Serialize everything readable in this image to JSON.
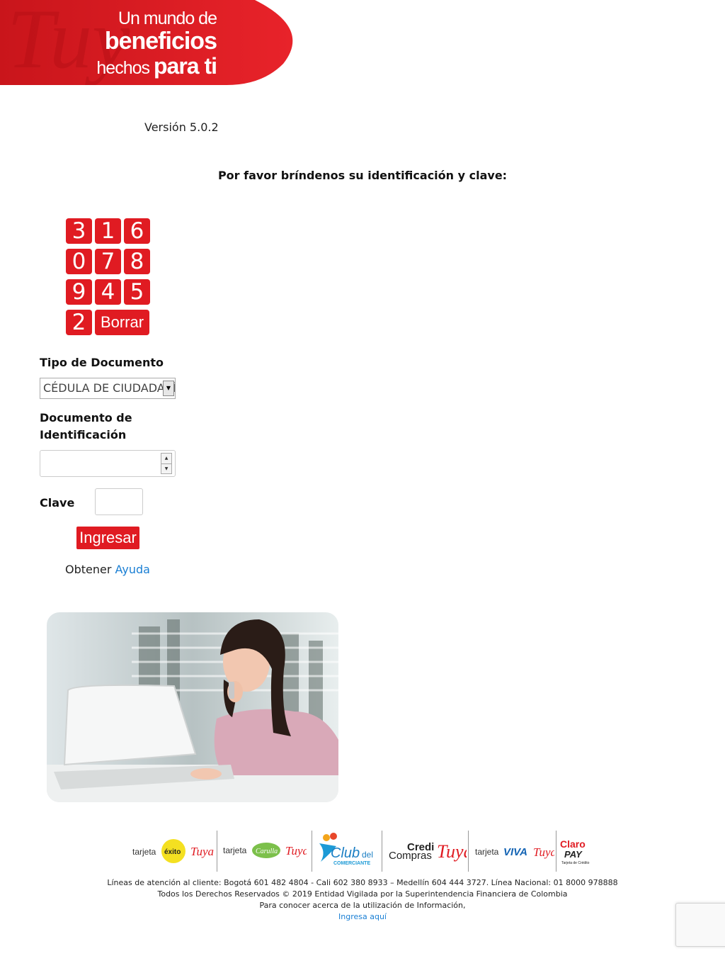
{
  "banner": {
    "line1": "Un mundo de",
    "line2": "beneficios",
    "line3a": "hechos",
    "line3b": "para ti",
    "brand_color": "#e01b22"
  },
  "version": "Versión 5.0.2",
  "prompt": "Por favor bríndenos su identificación y clave:",
  "keypad": {
    "keys": [
      "3",
      "1",
      "6",
      "0",
      "7",
      "8",
      "9",
      "4",
      "5",
      "2"
    ],
    "delete_label": "Borrar"
  },
  "form": {
    "doc_type_label": "Tipo de Documento",
    "doc_type_value": "CÉDULA DE CIUDADANÍA",
    "doc_number_label_1": "Documento de",
    "doc_number_label_2": "Identificación",
    "doc_number_value": "",
    "password_label": "Clave",
    "password_value": "",
    "submit_label": "Ingresar"
  },
  "help": {
    "prefix": "Obtener",
    "link": "Ayuda"
  },
  "footer": {
    "logos": [
      {
        "label_a": "tarjeta",
        "label_b": "éxito",
        "label_c": "Tuya"
      },
      {
        "label_a": "tarjeta",
        "label_b": "Carulla",
        "label_c": "Tuya"
      },
      {
        "label_a": "Club del",
        "label_b": "COMERCIANTE"
      },
      {
        "label_a": "Credi",
        "label_b": "Compras",
        "label_c": "Tuya"
      },
      {
        "label_a": "tarjeta",
        "label_b": "VIVA",
        "label_c": "Tuya"
      },
      {
        "label_a": "Claro",
        "label_b": "PAY",
        "label_c": "Tarjeta de Crédito"
      }
    ],
    "line1": "Líneas de atención al cliente: Bogotá 601 482 4804 - Cali 602 380 8933 – Medellín 604 444 3727. Línea Nacional: 01 8000 978888",
    "line2": "Todos los Derechos Reservados © 2019 Entidad Vigilada por la Superintendencia Financiera de Colombia",
    "line3": "Para conocer acerca de la utilización de Información,",
    "link": "Ingresa aquí"
  }
}
